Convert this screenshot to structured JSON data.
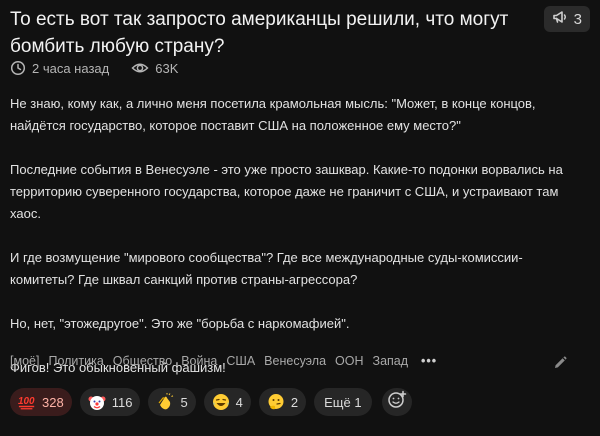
{
  "post": {
    "title": "То есть вот так запросто американцы решили, что могут бомбить любую страну?",
    "comments_count": "3",
    "time_ago": "2 часа назад",
    "views": "63K",
    "paragraphs": [
      "Не знаю, кому как, а лично меня посетила крамольная мысль: \"Может, в конце концов, найдётся государство, которое поставит США на положенное ему место?\"",
      "Последние события в Венесуэле - это уже просто зашквар. Какие-то подонки ворвались на территорию суверенного государства, которое даже не граничит с США, и устраивают там хаос.",
      "И где возмущение \"мирового сообщества\"? Где все международные суды-комиссии-комитеты? Где шквал санкций против страны-агрессора?",
      "Но, нет, \"этожедругое\". Это же \"борьба с наркомафией\".",
      "Фигов! Это обыкновенный фашизм!"
    ],
    "tags": [
      "[моё]",
      "Политика",
      "Общество",
      "Война",
      "США",
      "Венесуэла",
      "ООН",
      "Запад"
    ],
    "tags_more": "•••",
    "reactions": [
      {
        "icon": "hundred-emoji-icon",
        "count": "328",
        "active": true
      },
      {
        "icon": "clown-emoji-icon",
        "count": "116",
        "active": false
      },
      {
        "icon": "clapping-hands-emoji-icon",
        "count": "5",
        "active": false
      },
      {
        "icon": "laughing-emoji-icon",
        "count": "4",
        "active": false
      },
      {
        "icon": "thinking-emoji-icon",
        "count": "2",
        "active": false
      }
    ],
    "more_reactions_label": "Ещё 1"
  },
  "colors": {
    "background": "#111111",
    "chip": "#262626",
    "active_chip": "#3a1c1c",
    "active_text": "#ffb3a7"
  }
}
